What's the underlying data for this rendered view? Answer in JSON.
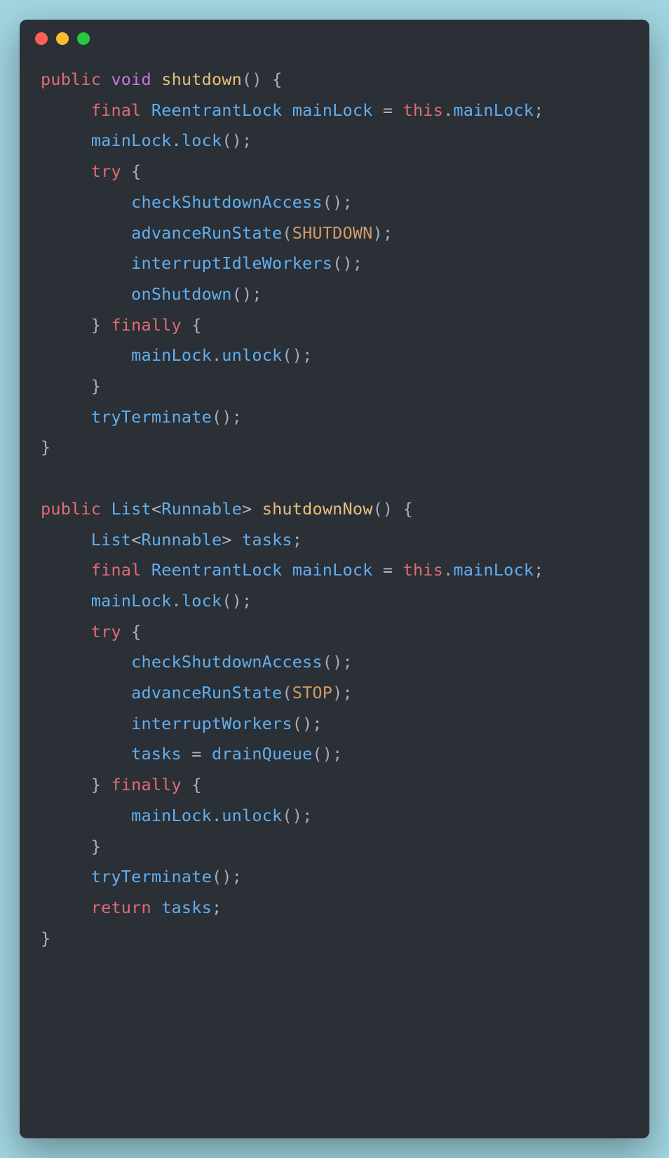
{
  "window": {
    "traffic": [
      "close",
      "minimize",
      "zoom"
    ]
  },
  "code": {
    "lines": [
      [
        {
          "t": "public",
          "c": "kw"
        },
        {
          "t": " "
        },
        {
          "t": "void",
          "c": "kw2"
        },
        {
          "t": " "
        },
        {
          "t": "shutdown",
          "c": "fn"
        },
        {
          "t": "()",
          "c": "par"
        },
        {
          "t": " {",
          "c": "pun"
        }
      ],
      [
        {
          "t": "     "
        },
        {
          "t": "final",
          "c": "kw"
        },
        {
          "t": " "
        },
        {
          "t": "ReentrantLock",
          "c": "typ"
        },
        {
          "t": " "
        },
        {
          "t": "mainLock",
          "c": "var"
        },
        {
          "t": " = ",
          "c": "pun"
        },
        {
          "t": "this",
          "c": "kw"
        },
        {
          "t": ".",
          "c": "pun"
        },
        {
          "t": "mainLock",
          "c": "var"
        },
        {
          "t": ";",
          "c": "pun"
        }
      ],
      [
        {
          "t": "     "
        },
        {
          "t": "mainLock",
          "c": "var"
        },
        {
          "t": ".",
          "c": "pun"
        },
        {
          "t": "lock",
          "c": "call"
        },
        {
          "t": "();",
          "c": "par"
        }
      ],
      [
        {
          "t": "     "
        },
        {
          "t": "try",
          "c": "kw"
        },
        {
          "t": " {",
          "c": "pun"
        }
      ],
      [
        {
          "t": "         "
        },
        {
          "t": "checkShutdownAccess",
          "c": "call"
        },
        {
          "t": "();",
          "c": "par"
        }
      ],
      [
        {
          "t": "         "
        },
        {
          "t": "advanceRunState",
          "c": "call"
        },
        {
          "t": "(",
          "c": "par"
        },
        {
          "t": "SHUTDOWN",
          "c": "cst"
        },
        {
          "t": ");",
          "c": "par"
        }
      ],
      [
        {
          "t": "         "
        },
        {
          "t": "interruptIdleWorkers",
          "c": "call"
        },
        {
          "t": "();",
          "c": "par"
        }
      ],
      [
        {
          "t": "         "
        },
        {
          "t": "onShutdown",
          "c": "call"
        },
        {
          "t": "();",
          "c": "par"
        }
      ],
      [
        {
          "t": "     } ",
          "c": "pun"
        },
        {
          "t": "finally",
          "c": "kw"
        },
        {
          "t": " {",
          "c": "pun"
        }
      ],
      [
        {
          "t": "         "
        },
        {
          "t": "mainLock",
          "c": "var"
        },
        {
          "t": ".",
          "c": "pun"
        },
        {
          "t": "unlock",
          "c": "call"
        },
        {
          "t": "();",
          "c": "par"
        }
      ],
      [
        {
          "t": "     }",
          "c": "pun"
        }
      ],
      [
        {
          "t": "     "
        },
        {
          "t": "tryTerminate",
          "c": "call"
        },
        {
          "t": "();",
          "c": "par"
        }
      ],
      [
        {
          "t": "}",
          "c": "pun"
        }
      ],
      [
        {
          "t": " "
        }
      ],
      [
        {
          "t": "public",
          "c": "kw"
        },
        {
          "t": " "
        },
        {
          "t": "List",
          "c": "typ"
        },
        {
          "t": "<",
          "c": "pun"
        },
        {
          "t": "Runnable",
          "c": "typ"
        },
        {
          "t": ">",
          "c": "pun"
        },
        {
          "t": " "
        },
        {
          "t": "shutdownNow",
          "c": "fn"
        },
        {
          "t": "()",
          "c": "par"
        },
        {
          "t": " {",
          "c": "pun"
        }
      ],
      [
        {
          "t": "     "
        },
        {
          "t": "List",
          "c": "typ"
        },
        {
          "t": "<",
          "c": "pun"
        },
        {
          "t": "Runnable",
          "c": "typ"
        },
        {
          "t": ">",
          "c": "pun"
        },
        {
          "t": " "
        },
        {
          "t": "tasks",
          "c": "var"
        },
        {
          "t": ";",
          "c": "pun"
        }
      ],
      [
        {
          "t": "     "
        },
        {
          "t": "final",
          "c": "kw"
        },
        {
          "t": " "
        },
        {
          "t": "ReentrantLock",
          "c": "typ"
        },
        {
          "t": " "
        },
        {
          "t": "mainLock",
          "c": "var"
        },
        {
          "t": " = ",
          "c": "pun"
        },
        {
          "t": "this",
          "c": "kw"
        },
        {
          "t": ".",
          "c": "pun"
        },
        {
          "t": "mainLock",
          "c": "var"
        },
        {
          "t": ";",
          "c": "pun"
        }
      ],
      [
        {
          "t": "     "
        },
        {
          "t": "mainLock",
          "c": "var"
        },
        {
          "t": ".",
          "c": "pun"
        },
        {
          "t": "lock",
          "c": "call"
        },
        {
          "t": "();",
          "c": "par"
        }
      ],
      [
        {
          "t": "     "
        },
        {
          "t": "try",
          "c": "kw"
        },
        {
          "t": " {",
          "c": "pun"
        }
      ],
      [
        {
          "t": "         "
        },
        {
          "t": "checkShutdownAccess",
          "c": "call"
        },
        {
          "t": "();",
          "c": "par"
        }
      ],
      [
        {
          "t": "         "
        },
        {
          "t": "advanceRunState",
          "c": "call"
        },
        {
          "t": "(",
          "c": "par"
        },
        {
          "t": "STOP",
          "c": "cst"
        },
        {
          "t": ");",
          "c": "par"
        }
      ],
      [
        {
          "t": "         "
        },
        {
          "t": "interruptWorkers",
          "c": "call"
        },
        {
          "t": "();",
          "c": "par"
        }
      ],
      [
        {
          "t": "         "
        },
        {
          "t": "tasks",
          "c": "var"
        },
        {
          "t": " = ",
          "c": "pun"
        },
        {
          "t": "drainQueue",
          "c": "call"
        },
        {
          "t": "();",
          "c": "par"
        }
      ],
      [
        {
          "t": "     } ",
          "c": "pun"
        },
        {
          "t": "finally",
          "c": "kw"
        },
        {
          "t": " {",
          "c": "pun"
        }
      ],
      [
        {
          "t": "         "
        },
        {
          "t": "mainLock",
          "c": "var"
        },
        {
          "t": ".",
          "c": "pun"
        },
        {
          "t": "unlock",
          "c": "call"
        },
        {
          "t": "();",
          "c": "par"
        }
      ],
      [
        {
          "t": "     }",
          "c": "pun"
        }
      ],
      [
        {
          "t": "     "
        },
        {
          "t": "tryTerminate",
          "c": "call"
        },
        {
          "t": "();",
          "c": "par"
        }
      ],
      [
        {
          "t": "     "
        },
        {
          "t": "return",
          "c": "kw"
        },
        {
          "t": " "
        },
        {
          "t": "tasks",
          "c": "var"
        },
        {
          "t": ";",
          "c": "pun"
        }
      ],
      [
        {
          "t": "}",
          "c": "pun"
        }
      ]
    ]
  },
  "colors": {
    "background_page": "#a0d4e0",
    "background_window": "#2b2f36",
    "keyword": "#e06c75",
    "keyword2": "#c678dd",
    "function": "#e5c07b",
    "type": "#61afef",
    "identifier": "#61afef",
    "punctuation": "#abb2bf",
    "constant": "#d19a66"
  }
}
